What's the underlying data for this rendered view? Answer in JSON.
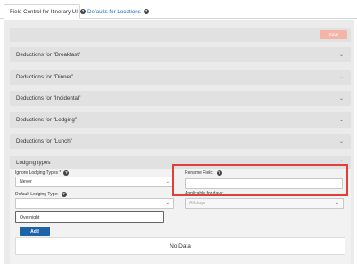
{
  "tabs": [
    {
      "label": "Field Control for Itinerary UI",
      "active": true
    },
    {
      "label": "Defaults for Locations",
      "active": false
    }
  ],
  "toolbar": {
    "save_label": "Save"
  },
  "sections": [
    {
      "label": "Deductions for \"Breakfast\""
    },
    {
      "label": "Deductions for \"Dinner\""
    },
    {
      "label": "Deductions for \"Incidental\""
    },
    {
      "label": "Deductions for \"Lodging\""
    },
    {
      "label": "Deductions for \"Lunch\""
    }
  ],
  "lodging": {
    "title": "Lodging types",
    "ignore_label": "Ignore Lodging Types *",
    "ignore_value": "Never",
    "rename_label": "Rename Field:",
    "rename_value": "",
    "default_label": "Default Lodging Type:",
    "default_value": "",
    "applicable_label": "Applicable for days:",
    "applicable_value": "All days",
    "dropdown_option": "Overnight",
    "add_label": "Add",
    "nodata": "No Data"
  },
  "colors": {
    "highlight": "#e0403a",
    "accent": "#1e63a8",
    "save_disabled": "#f6b3a7"
  }
}
